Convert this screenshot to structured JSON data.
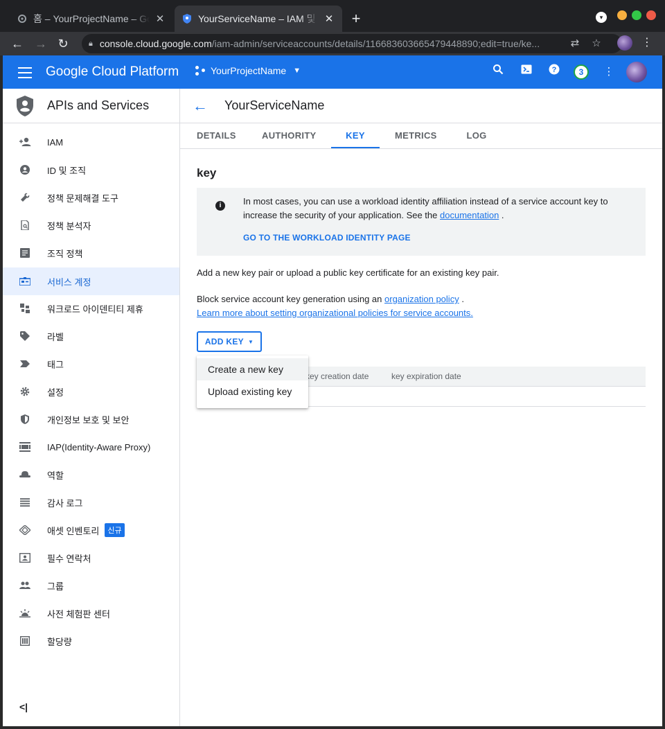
{
  "browser": {
    "tabs": [
      {
        "title": "홈 – YourProjectName – Google Cloud",
        "close": "✕"
      },
      {
        "title": "YourServiceName – IAM 및 관리자",
        "close": "✕"
      }
    ],
    "new_tab": "+",
    "url_host": "console.cloud.google.com",
    "url_path": "/iam-admin/serviceaccounts/details/116683603665479448890;edit=true/ke..."
  },
  "header": {
    "brand": "Google Cloud Platform",
    "project": "YourProjectName",
    "notifications": "3"
  },
  "sidebar": {
    "title": "APIs and Services",
    "items": [
      {
        "label": "IAM",
        "icon": "person-add-icon"
      },
      {
        "label": "ID 및 조직",
        "icon": "account-circle-icon"
      },
      {
        "label": "정책 문제해결 도구",
        "icon": "wrench-icon"
      },
      {
        "label": "정책 분석자",
        "icon": "document-search-icon"
      },
      {
        "label": "조직 정책",
        "icon": "list-box-icon"
      },
      {
        "label": "서비스 계정",
        "icon": "service-account-icon"
      },
      {
        "label": "워크로드 아이덴티티 제휴",
        "icon": "workload-identity-icon"
      },
      {
        "label": "라벨",
        "icon": "tag-icon"
      },
      {
        "label": "태그",
        "icon": "chevron-tag-icon"
      },
      {
        "label": "설정",
        "icon": "gear-icon"
      },
      {
        "label": "개인정보 보호 및 보안",
        "icon": "shield-icon"
      },
      {
        "label": "IAP(Identity-Aware Proxy)",
        "icon": "iap-icon"
      },
      {
        "label": "역할",
        "icon": "hat-icon"
      },
      {
        "label": "감사 로그",
        "icon": "lines-icon"
      },
      {
        "label": "애셋 인벤토리",
        "icon": "diamond-icon",
        "badge": "신규"
      },
      {
        "label": "필수 연락처",
        "icon": "contact-card-icon"
      },
      {
        "label": "그룹",
        "icon": "group-icon"
      },
      {
        "label": "사전 체험판 센터",
        "icon": "sunrise-icon"
      },
      {
        "label": "할당량",
        "icon": "quota-icon"
      }
    ],
    "active_index": 5,
    "collapse": "<|"
  },
  "main": {
    "title": "YourServiceName",
    "tabs": [
      "DETAILS",
      "AUTHORITY",
      "KEY",
      "METRICS",
      "LOG"
    ],
    "active_tab": 2,
    "section_title": "key",
    "info": {
      "text_before": "In most cases, you can use a workload identity affiliation instead of a service account key to increase the security of your application. See the",
      "link": "documentation",
      "text_after": ".",
      "action": "GO TO THE WORKLOAD IDENTITY PAGE"
    },
    "p1": "Add a new key pair or upload a public key certificate for an existing key pair.",
    "p2_before": "Block service account key generation using an",
    "p2_link": "organization policy",
    "p2_after": ".",
    "p2_link2": "Learn more about setting organizational policies for service accounts.",
    "add_key": "ADD KEY",
    "table_headers": [
      "key creation date",
      "key expiration date"
    ],
    "menu": [
      "Create a new key",
      "Upload existing key"
    ]
  }
}
